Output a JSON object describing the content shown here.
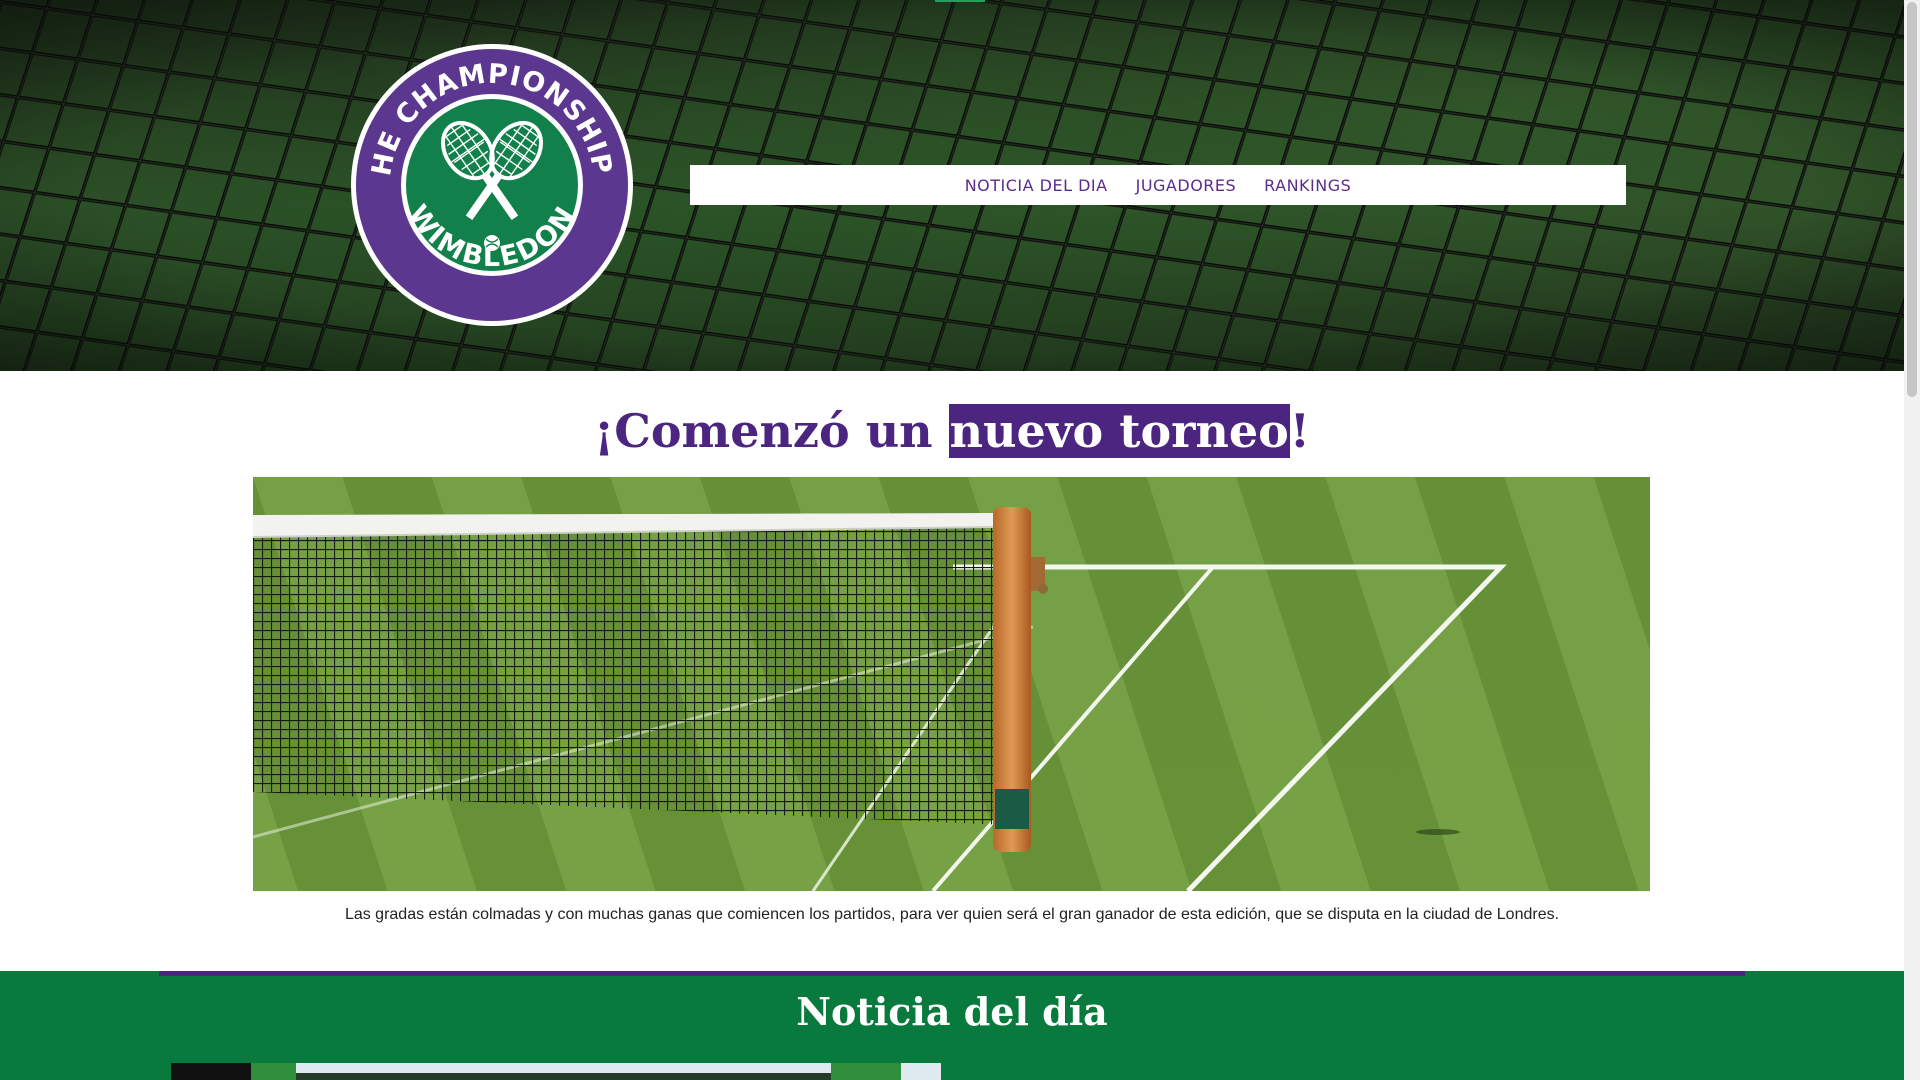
{
  "header": {
    "logo": {
      "top_text": "THE CHAMPIONSHIPS",
      "bottom_text": "WIMBLEDON",
      "icon": "crossed-rackets-icon"
    },
    "nav": [
      {
        "label": "NOTICIA DEL DIA"
      },
      {
        "label": "JUGADORES"
      },
      {
        "label": "RANKINGS"
      }
    ]
  },
  "main": {
    "title_part1": "¡Comenzó un ",
    "title_highlight": "nuevo torneo",
    "title_part2": "!",
    "caption": "Las gradas están colmadas y con muchas ganas que comiencen los partidos, para ver quien será el gran ganador de esta edición, que se disputa en la ciudad de Londres."
  },
  "news": {
    "title": "Noticia del día"
  },
  "colors": {
    "purple": "#4b2580",
    "green": "#087a3d",
    "logo_purple": "#5c3790",
    "logo_green": "#11804a"
  }
}
